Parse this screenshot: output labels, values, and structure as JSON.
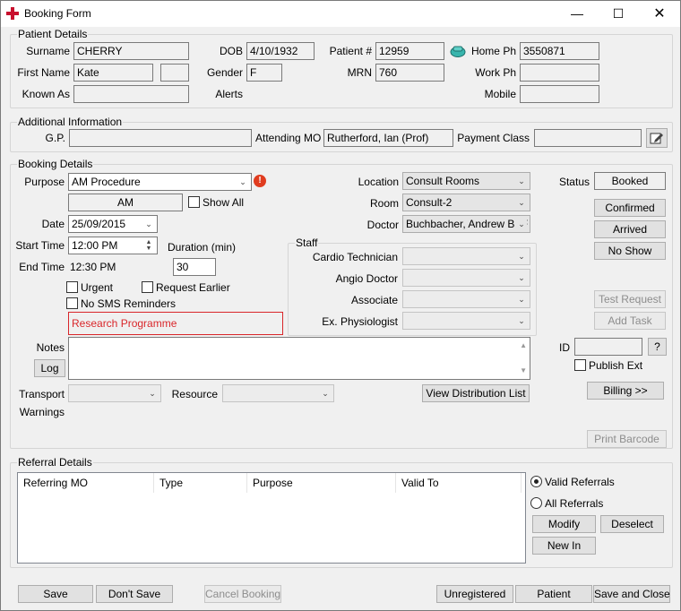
{
  "window": {
    "title": "Booking Form"
  },
  "patient": {
    "group_label": "Patient Details",
    "surname_label": "Surname",
    "surname": "CHERRY",
    "firstname_label": "First Name",
    "firstname": "Kate",
    "knownas_label": "Known As",
    "knownas": "",
    "dob_label": "DOB",
    "dob": "4/10/1932",
    "gender_label": "Gender",
    "gender": "F",
    "alerts_label": "Alerts",
    "patientno_label": "Patient #",
    "patientno": "12959",
    "mrn_label": "MRN",
    "mrn": "760",
    "homeph_label": "Home Ph",
    "homeph": "3550871",
    "workph_label": "Work Ph",
    "workph": "",
    "mobile_label": "Mobile",
    "mobile": ""
  },
  "additional": {
    "group_label": "Additional Information",
    "gp_label": "G.P.",
    "gp": "",
    "attending_label": "Attending MO",
    "attending": "Rutherford, Ian (Prof)",
    "payment_label": "Payment Class",
    "payment": ""
  },
  "booking": {
    "group_label": "Booking Details",
    "purpose_label": "Purpose",
    "purpose": "AM Procedure",
    "ampm": "AM",
    "showall_label": "Show All",
    "date_label": "Date",
    "date": "25/09/2015",
    "start_label": "Start Time",
    "start": "12:00 PM",
    "duration_label": "Duration (min)",
    "duration": "30",
    "end_label": "End Time",
    "end": "12:30 PM",
    "urgent_label": "Urgent",
    "request_earlier_label": "Request Earlier",
    "nosms_label": "No SMS Reminders",
    "research": "Research Programme",
    "notes_label": "Notes",
    "log_label": "Log",
    "transport_label": "Transport",
    "warnings_label": "Warnings",
    "resource_label": "Resource",
    "view_dist_label": "View Distribution List",
    "location_label": "Location",
    "location": "Consult Rooms",
    "room_label": "Room",
    "room": "Consult-2",
    "doctor_label": "Doctor",
    "doctor": "Buchbacher, Andrew B (F",
    "staff_label": "Staff",
    "cardio_label": "Cardio Technician",
    "angio_label": "Angio Doctor",
    "associate_label": "Associate",
    "physio_label": "Ex. Physiologist",
    "status_label": "Status",
    "status": "Booked",
    "confirmed_label": "Confirmed",
    "arrived_label": "Arrived",
    "noshow_label": "No Show",
    "testrequest_label": "Test Request",
    "addtask_label": "Add Task",
    "id_label": "ID",
    "id": "",
    "idhelp_label": "?",
    "publish_label": "Publish Ext",
    "billing_label": "Billing >>",
    "printbarcode_label": "Print Barcode"
  },
  "referral": {
    "group_label": "Referral Details",
    "columns": [
      "Referring MO",
      "Type",
      "Purpose",
      "Valid To"
    ],
    "valid_label": "Valid Referrals",
    "all_label": "All Referrals",
    "modify_label": "Modify",
    "deselect_label": "Deselect",
    "newin_label": "New In"
  },
  "footer": {
    "save": "Save",
    "dontsave": "Don't Save",
    "cancel": "Cancel Booking",
    "unregistered": "Unregistered",
    "patient": "Patient",
    "saveclose": "Save and Close"
  },
  "icons": {
    "minimize": "minimize-icon",
    "maximize": "maximize-icon",
    "close": "close-icon",
    "phone": "phone-icon",
    "warning": "warning-icon",
    "edit": "edit-icon"
  },
  "colors": {
    "research_red": "#d9262a",
    "warning_red": "#e03c1f",
    "accent_teal": "#2aa7a0"
  }
}
